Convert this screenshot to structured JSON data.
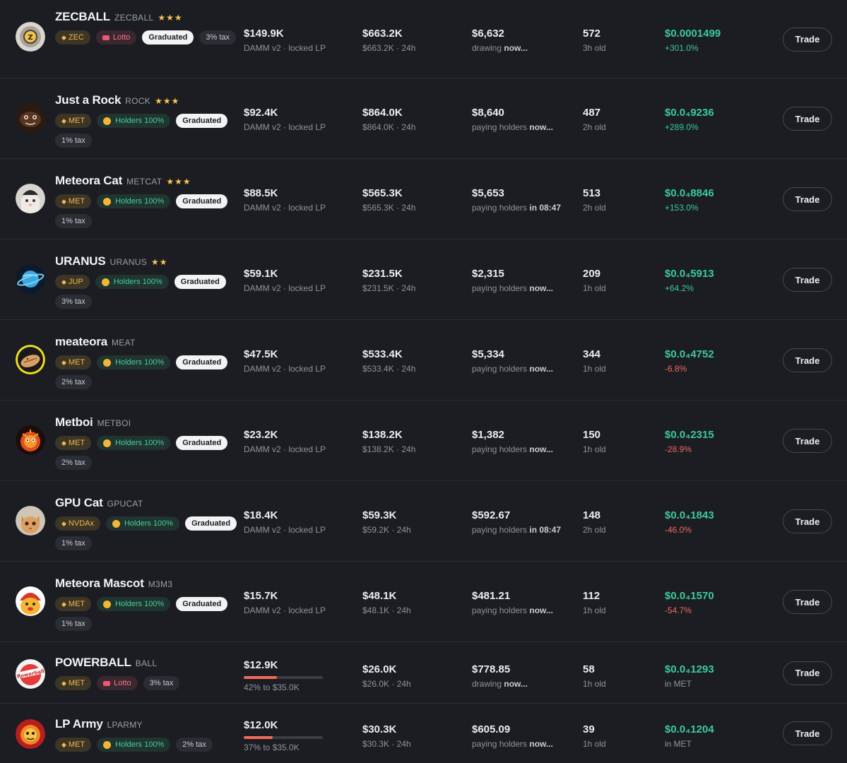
{
  "tokens": [
    {
      "name": "ZECBALL",
      "symbol": "ZECBALL",
      "stars": "★★★",
      "avatar": "zec",
      "badges": [
        {
          "kind": "base",
          "text": "ZEC"
        },
        {
          "kind": "lotto",
          "text": "Lotto"
        },
        {
          "kind": "grad",
          "text": "Graduated"
        },
        {
          "kind": "tax",
          "text": "3% tax"
        }
      ],
      "mcap": "$149.9K",
      "mcap_sub": "DAMM v2 · locked LP",
      "vol": "$663.2K",
      "vol_sub": "$663.2K · 24h",
      "reward": "$6,632",
      "reward_sub": "drawing ",
      "reward_when": "now...",
      "holders": "572",
      "age": "3h old",
      "price": "$0.0001499",
      "change": "+301.0%",
      "change_dir": "pos",
      "trade": "Trade"
    },
    {
      "name": "Just a Rock",
      "symbol": "ROCK",
      "stars": "★★★",
      "avatar": "rock",
      "badges": [
        {
          "kind": "base",
          "text": "MET"
        },
        {
          "kind": "hold",
          "text": "Holders 100%"
        },
        {
          "kind": "grad",
          "text": "Graduated"
        },
        {
          "kind": "tax",
          "text": "1% tax"
        }
      ],
      "mcap": "$92.4K",
      "mcap_sub": "DAMM v2 · locked LP",
      "vol": "$864.0K",
      "vol_sub": "$864.0K · 24h",
      "reward": "$8,640",
      "reward_sub": "paying holders ",
      "reward_when": "now...",
      "holders": "487",
      "age": "2h old",
      "price": "$0.0₄9236",
      "change": "+289.0%",
      "change_dir": "pos",
      "trade": "Trade"
    },
    {
      "name": "Meteora Cat",
      "symbol": "METCAT",
      "stars": "★★★",
      "avatar": "cat",
      "badges": [
        {
          "kind": "base",
          "text": "MET"
        },
        {
          "kind": "hold",
          "text": "Holders 100%"
        },
        {
          "kind": "grad",
          "text": "Graduated"
        },
        {
          "kind": "tax",
          "text": "1% tax"
        }
      ],
      "mcap": "$88.5K",
      "mcap_sub": "DAMM v2 · locked LP",
      "vol": "$565.3K",
      "vol_sub": "$565.3K · 24h",
      "reward": "$5,653",
      "reward_sub": "paying holders ",
      "reward_when": "in 08:47",
      "holders": "513",
      "age": "2h old",
      "price": "$0.0₄8846",
      "change": "+153.0%",
      "change_dir": "pos",
      "trade": "Trade"
    },
    {
      "name": "URANUS",
      "symbol": "URANUS",
      "stars": "★★",
      "avatar": "planet",
      "badges": [
        {
          "kind": "base",
          "text": "JUP"
        },
        {
          "kind": "hold",
          "text": "Holders 100%"
        },
        {
          "kind": "grad",
          "text": "Graduated"
        },
        {
          "kind": "tax",
          "text": "3% tax"
        }
      ],
      "mcap": "$59.1K",
      "mcap_sub": "DAMM v2 · locked LP",
      "vol": "$231.5K",
      "vol_sub": "$231.5K · 24h",
      "reward": "$2,315",
      "reward_sub": "paying holders ",
      "reward_when": "now...",
      "holders": "209",
      "age": "1h old",
      "price": "$0.0₄5913",
      "change": "+64.2%",
      "change_dir": "pos",
      "trade": "Trade"
    },
    {
      "name": "meateora",
      "symbol": "MEAT",
      "stars": "",
      "avatar": "meat",
      "badges": [
        {
          "kind": "base",
          "text": "MET"
        },
        {
          "kind": "hold",
          "text": "Holders 100%"
        },
        {
          "kind": "grad",
          "text": "Graduated"
        },
        {
          "kind": "tax",
          "text": "2% tax"
        }
      ],
      "mcap": "$47.5K",
      "mcap_sub": "DAMM v2 · locked LP",
      "vol": "$533.4K",
      "vol_sub": "$533.4K · 24h",
      "reward": "$5,334",
      "reward_sub": "paying holders ",
      "reward_when": "now...",
      "holders": "344",
      "age": "1h old",
      "price": "$0.0₄4752",
      "change": "-6.8%",
      "change_dir": "neg",
      "trade": "Trade"
    },
    {
      "name": "Metboi",
      "symbol": "METBOI",
      "stars": "",
      "avatar": "boi",
      "badges": [
        {
          "kind": "base",
          "text": "MET"
        },
        {
          "kind": "hold",
          "text": "Holders 100%"
        },
        {
          "kind": "grad",
          "text": "Graduated"
        },
        {
          "kind": "tax",
          "text": "2% tax"
        }
      ],
      "mcap": "$23.2K",
      "mcap_sub": "DAMM v2 · locked LP",
      "vol": "$138.2K",
      "vol_sub": "$138.2K · 24h",
      "reward": "$1,382",
      "reward_sub": "paying holders ",
      "reward_when": "now...",
      "holders": "150",
      "age": "1h old",
      "price": "$0.0₄2315",
      "change": "-28.9%",
      "change_dir": "neg",
      "trade": "Trade"
    },
    {
      "name": "GPU Cat",
      "symbol": "GPUCAT",
      "stars": "",
      "avatar": "kitten",
      "badges": [
        {
          "kind": "base",
          "text": "NVDAx"
        },
        {
          "kind": "hold",
          "text": "Holders 100%"
        },
        {
          "kind": "grad",
          "text": "Graduated"
        },
        {
          "kind": "tax",
          "text": "1% tax"
        }
      ],
      "mcap": "$18.4K",
      "mcap_sub": "DAMM v2 · locked LP",
      "vol": "$59.3K",
      "vol_sub": "$59.2K · 24h",
      "reward": "$592.67",
      "reward_sub": "paying holders ",
      "reward_when": "in 08:47",
      "holders": "148",
      "age": "2h old",
      "price": "$0.0₄1843",
      "change": "-46.0%",
      "change_dir": "neg",
      "trade": "Trade"
    },
    {
      "name": "Meteora Mascot",
      "symbol": "M3M3",
      "stars": "",
      "avatar": "mascot",
      "badges": [
        {
          "kind": "base",
          "text": "MET"
        },
        {
          "kind": "hold",
          "text": "Holders 100%"
        },
        {
          "kind": "grad",
          "text": "Graduated"
        },
        {
          "kind": "tax",
          "text": "1% tax"
        }
      ],
      "mcap": "$15.7K",
      "mcap_sub": "DAMM v2 · locked LP",
      "vol": "$48.1K",
      "vol_sub": "$48.1K · 24h",
      "reward": "$481.21",
      "reward_sub": "paying holders ",
      "reward_when": "now...",
      "holders": "112",
      "age": "1h old",
      "price": "$0.0₄1570",
      "change": "-54.7%",
      "change_dir": "neg",
      "trade": "Trade"
    },
    {
      "name": "POWERBALL",
      "symbol": "BALL",
      "stars": "",
      "avatar": "powerball",
      "progress": 0.42,
      "badges": [
        {
          "kind": "base",
          "text": "MET"
        },
        {
          "kind": "lotto",
          "text": "Lotto"
        },
        {
          "kind": "tax",
          "text": "3% tax"
        }
      ],
      "mcap": "$12.9K",
      "mcap_sub": "42% to $35.0K",
      "vol": "$26.0K",
      "vol_sub": "$26.0K · 24h",
      "reward": "$778.85",
      "reward_sub": "drawing ",
      "reward_when": "now...",
      "holders": "58",
      "age": "1h old",
      "price": "$0.0₄1293",
      "change": "in MET",
      "change_dir": "neutral",
      "trade": "Trade"
    },
    {
      "name": "LP Army",
      "symbol": "LPARMY",
      "stars": "",
      "avatar": "army",
      "progress": 0.37,
      "badges": [
        {
          "kind": "base",
          "text": "MET"
        },
        {
          "kind": "hold",
          "text": "Holders 100%"
        },
        {
          "kind": "tax",
          "text": "2% tax"
        }
      ],
      "mcap": "$12.0K",
      "mcap_sub": "37% to $35.0K",
      "vol": "$30.3K",
      "vol_sub": "$30.3K · 24h",
      "reward": "$605.09",
      "reward_sub": "paying holders ",
      "reward_when": "now...",
      "holders": "39",
      "age": "1h old",
      "price": "$0.0₄1204",
      "change": "in MET",
      "change_dir": "neutral",
      "trade": "Trade"
    }
  ]
}
